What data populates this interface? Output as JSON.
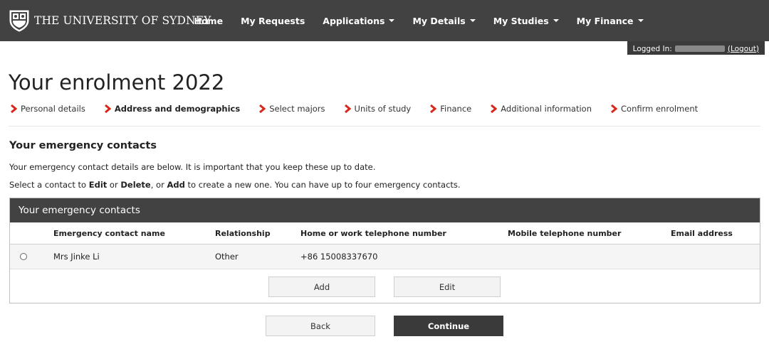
{
  "header": {
    "logo_text": "THE UNIVERSITY OF SYDNEY",
    "nav": [
      {
        "label": "Home",
        "dropdown": false
      },
      {
        "label": "My Requests",
        "dropdown": false
      },
      {
        "label": "Applications",
        "dropdown": true
      },
      {
        "label": "My Details",
        "dropdown": true
      },
      {
        "label": "My Studies",
        "dropdown": true
      },
      {
        "label": "My Finance",
        "dropdown": true
      }
    ],
    "logged_in_label": "Logged In:",
    "logout_label": "(Logout)"
  },
  "page": {
    "title": "Your enrolment 2022",
    "steps": [
      {
        "label": "Personal details",
        "active": false
      },
      {
        "label": "Address and demographics",
        "active": true
      },
      {
        "label": "Select majors",
        "active": false
      },
      {
        "label": "Units of study",
        "active": false
      },
      {
        "label": "Finance",
        "active": false
      },
      {
        "label": "Additional information",
        "active": false
      },
      {
        "label": "Confirm enrolment",
        "active": false
      }
    ],
    "section_title": "Your emergency contacts",
    "description": "Your emergency contact details are below. It is important that you keep these up to date.",
    "instruction": {
      "select_prefix": "Select a contact to ",
      "edit": "Edit",
      "or": " or ",
      "delete": "Delete",
      "comma_or": ", or ",
      "add": "Add",
      "suffix": " to create a new one. You can have up to four emergency contacts."
    }
  },
  "contacts_panel": {
    "heading": "Your emergency contacts",
    "columns": [
      "Emergency contact name",
      "Relationship",
      "Home or work telephone number",
      "Mobile telephone number",
      "Email address"
    ],
    "rows": [
      {
        "name": "Mrs Jinke Li",
        "relationship": "Other",
        "home_phone": "+86 15008337670",
        "mobile": "",
        "email": ""
      }
    ],
    "add_label": "Add",
    "edit_label": "Edit"
  },
  "footer": {
    "back_label": "Back",
    "continue_label": "Continue"
  },
  "colors": {
    "header_bg": "#424242",
    "step_arrow": "#d9261c",
    "primary_button": "#3a3a3a"
  },
  "icons": [
    "university-crest-icon",
    "chevron-down-icon",
    "step-arrow-icon",
    "radio-button"
  ]
}
